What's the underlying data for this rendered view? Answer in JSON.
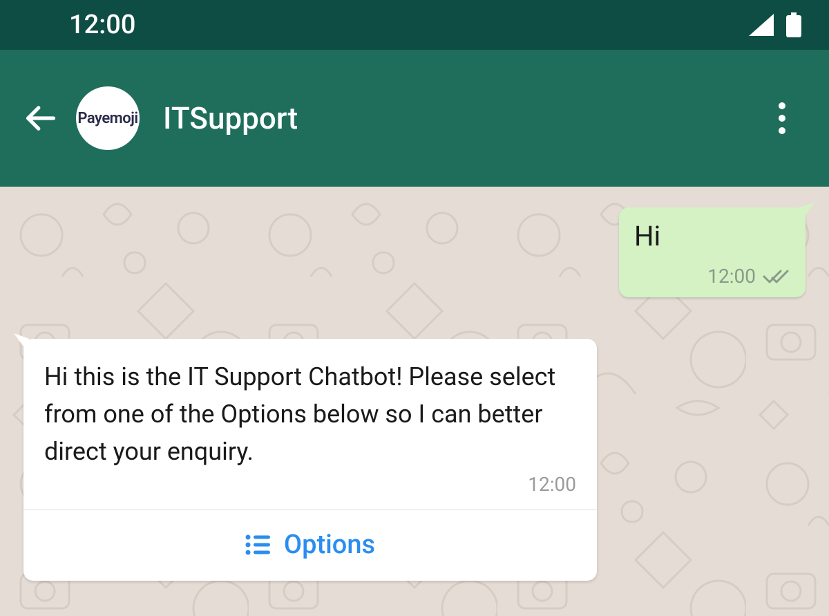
{
  "status": {
    "time": "12:00"
  },
  "header": {
    "avatar_text": "Payemoji",
    "title": "ITSupport"
  },
  "messages": {
    "out1": {
      "text": "Hi",
      "time": "12:00"
    },
    "in1": {
      "text": "Hi this is the IT Support Chatbot! Please select from one of the Options below so I can better direct your enquiry.",
      "time": "12:00",
      "action_label": "Options"
    }
  }
}
